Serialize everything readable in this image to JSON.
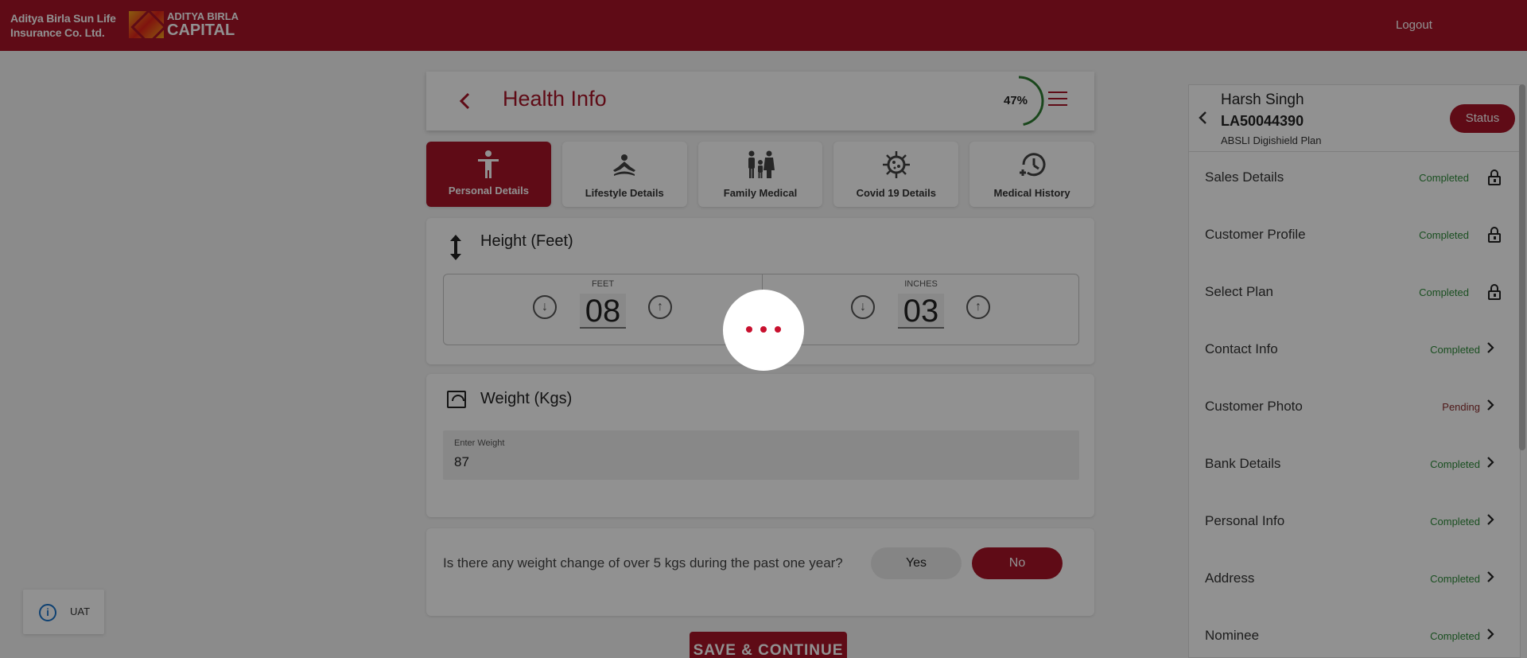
{
  "brand": {
    "company_line1": "Aditya Birla Sun Life",
    "company_line2": "Insurance Co. Ltd.",
    "logo_line1": "ADITYA BIRLA",
    "logo_line2": "CAPITAL"
  },
  "topbar": {
    "logout_label": "Logout",
    "color": "#a81527"
  },
  "header": {
    "title": "Health Info",
    "progress_label": "47%",
    "progress": 0.47
  },
  "tabs": [
    {
      "label": "Personal Details",
      "icon": "person-arms-out-icon",
      "active": true
    },
    {
      "label": "Lifestyle Details",
      "icon": "meditation-icon",
      "active": false
    },
    {
      "label": "Family Medical",
      "icon": "family-icon",
      "active": false
    },
    {
      "label": "Covid 19 Details",
      "icon": "virus-icon",
      "active": false
    },
    {
      "label": "Medical History",
      "icon": "history-clock-icon",
      "active": false
    }
  ],
  "height": {
    "title": "Height (Feet)",
    "feet_label": "FEET",
    "feet_value": "08",
    "inches_label": "INCHES",
    "inches_value": "03"
  },
  "weight": {
    "title": "Weight (Kgs)",
    "field_label": "Enter Weight",
    "field_value": "87"
  },
  "question": {
    "text": "Is there any weight change of over 5 kgs during the past one year?",
    "yes_label": "Yes",
    "no_label": "No",
    "selected": "No"
  },
  "save_label": "SAVE & CONTINUE",
  "side": {
    "customer_name": "Harsh Singh",
    "application_no": "LA50044390",
    "plan_name": "ABSLI Digishield Plan",
    "status_label": "Status",
    "items": [
      {
        "label": "Sales Details",
        "state": "Completed",
        "trail": "lock-icon"
      },
      {
        "label": "Customer Profile",
        "state": "Completed",
        "trail": "lock-icon"
      },
      {
        "label": "Select Plan",
        "state": "Completed",
        "trail": "lock-icon"
      },
      {
        "label": "Contact Info",
        "state": "Completed",
        "trail": "chevron-right-icon"
      },
      {
        "label": "Customer Photo",
        "state": "Pending",
        "trail": "chevron-right-icon"
      },
      {
        "label": "Bank Details",
        "state": "Completed",
        "trail": "chevron-right-icon"
      },
      {
        "label": "Personal Info",
        "state": "Completed",
        "trail": "chevron-right-icon"
      },
      {
        "label": "Address",
        "state": "Completed",
        "trail": "chevron-right-icon"
      },
      {
        "label": "Nominee",
        "state": "Completed",
        "trail": "chevron-right-icon"
      }
    ]
  },
  "env_badge": {
    "label": "UAT",
    "icon": "info-icon"
  },
  "colors": {
    "accent": "#a81527",
    "completed": "#2e8b3a",
    "pending": "#8a2c2c",
    "progress_ring": "#2e7d32"
  }
}
